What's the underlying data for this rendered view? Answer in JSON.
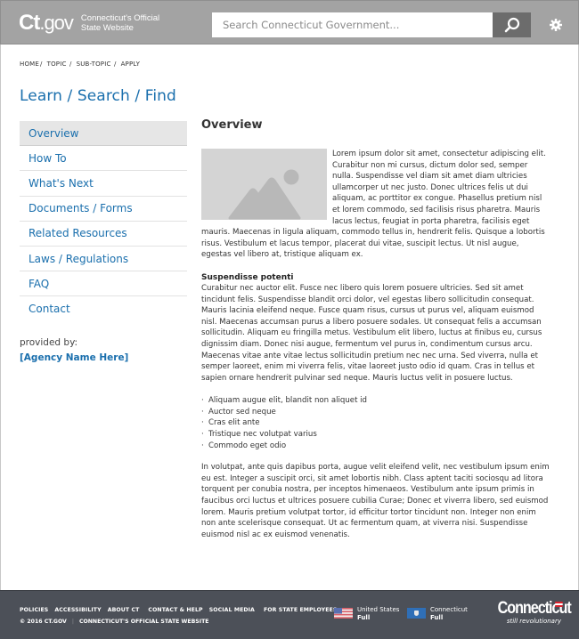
{
  "header": {
    "logo_mark": "Ct",
    "logo_gov": ".gov",
    "tagline_line1": "Connecticut's Official",
    "tagline_line2": "State Website",
    "search_placeholder": "Search Connecticut Government...",
    "search_icon": "search-icon",
    "settings_icon": "gear-icon"
  },
  "breadcrumb": [
    "HOME",
    "TOPIC",
    "SUB-TOPIC",
    "APPLY"
  ],
  "section_title": "Learn / Search / Find",
  "sidebar": {
    "items": [
      {
        "label": "Overview",
        "active": true
      },
      {
        "label": "How To",
        "active": false
      },
      {
        "label": "What's Next",
        "active": false
      },
      {
        "label": "Documents / Forms",
        "active": false
      },
      {
        "label": "Related Resources",
        "active": false
      },
      {
        "label": "Laws / Regulations",
        "active": false
      },
      {
        "label": "FAQ",
        "active": false
      },
      {
        "label": "Contact",
        "active": false
      }
    ],
    "provided_by": "provided by:",
    "agency": "[Agency Name Here]"
  },
  "main": {
    "title": "Overview",
    "image_icon": "image-placeholder-icon",
    "intro": "Lorem ipsum dolor sit amet, consectetur adipiscing elit. Curabitur non mi cursus, dictum dolor sed, semper nulla. Suspendisse vel diam sit amet diam ultricies ullamcorper ut nec justo. Donec ultrices felis ut dui aliquam, ac porttitor ex congue. Phasellus pretium nisl et lorem commodo, sed facilisis risus pharetra. Mauris lacus lectus, feugiat in porta pharetra, facilisis eget mauris. Maecenas in ligula aliquam, commodo tellus in, hendrerit felis. Quisque a lobortis risus. Vestibulum et lacus tempor, placerat dui vitae, suscipit lectus. Ut nisl augue, egestas vel libero at, tristique aliquam ex.",
    "subheading": "Suspendisse potenti",
    "paragraph2": "Curabitur nec auctor elit. Fusce nec libero quis lorem posuere ultricies. Sed sit amet tincidunt felis. Suspendisse blandit orci dolor, vel egestas libero sollicitudin consequat. Mauris lacinia eleifend neque. Fusce quam risus, cursus ut purus vel, aliquam euismod nisl. Maecenas accumsan purus a libero posuere sodales. Ut consequat felis a accumsan sollicitudin. Aliquam eu fringilla metus. Vestibulum elit libero, luctus at finibus eu, cursus dignissim diam. Donec nisi augue, fermentum vel purus in, condimentum cursus arcu. Maecenas vitae ante vitae lectus sollicitudin pretium nec nec urna. Sed viverra, nulla et semper laoreet, enim mi viverra felis, vitae laoreet justo odio id quam. Cras in tellus et sapien ornare hendrerit pulvinar sed neque. Mauris luctus velit in posuere luctus.",
    "bullets": [
      "Aliquam augue elit, blandit non aliquet id",
      "Auctor sed neque",
      "Cras elit ante",
      "Tristique nec volutpat varius",
      "Commodo eget odio"
    ],
    "paragraph3": "In volutpat, ante quis dapibus porta, augue velit eleifend velit, nec vestibulum ipsum enim eu est. Integer a suscipit orci, sit amet lobortis nibh. Class aptent taciti sociosqu ad litora torquent per conubia nostra, per inceptos himenaeos. Vestibulum ante ipsum primis in faucibus orci luctus et ultrices posuere cubilia Curae; Donec et viverra libero, sed euismod lorem. Mauris pretium volutpat tortor, id efficitur tortor tincidunt non. Integer non enim non ante scelerisque consequat. Ut ac fermentum quam, at viverra nisi. Suspendisse euismod nisl ac ex euismod venenatis."
  },
  "footer": {
    "links": [
      "POLICIES",
      "ACCESSIBILITY",
      "ABOUT CT",
      "CONTACT & HELP",
      "SOCIAL MEDIA",
      "FOR STATE EMPLOYEES"
    ],
    "copyright": "© 2016 CT.GOV",
    "divider": "|",
    "site_name": "CONNECTICUT'S OFFICIAL STATE WEBSITE",
    "flags": [
      {
        "name": "United States",
        "status": "Full",
        "icon": "us-flag-icon"
      },
      {
        "name": "Connecticut",
        "status": "Full",
        "icon": "ct-flag-icon"
      }
    ],
    "brand_word": "Connecticut",
    "brand_slogan": "still revolutionary"
  },
  "colors": {
    "header_bg": "#a3a3a3",
    "link_blue": "#1a6fad",
    "footer_bg": "#4c5058",
    "search_button": "#6c6c6c",
    "active_nav_bg": "#e6e6e6"
  }
}
